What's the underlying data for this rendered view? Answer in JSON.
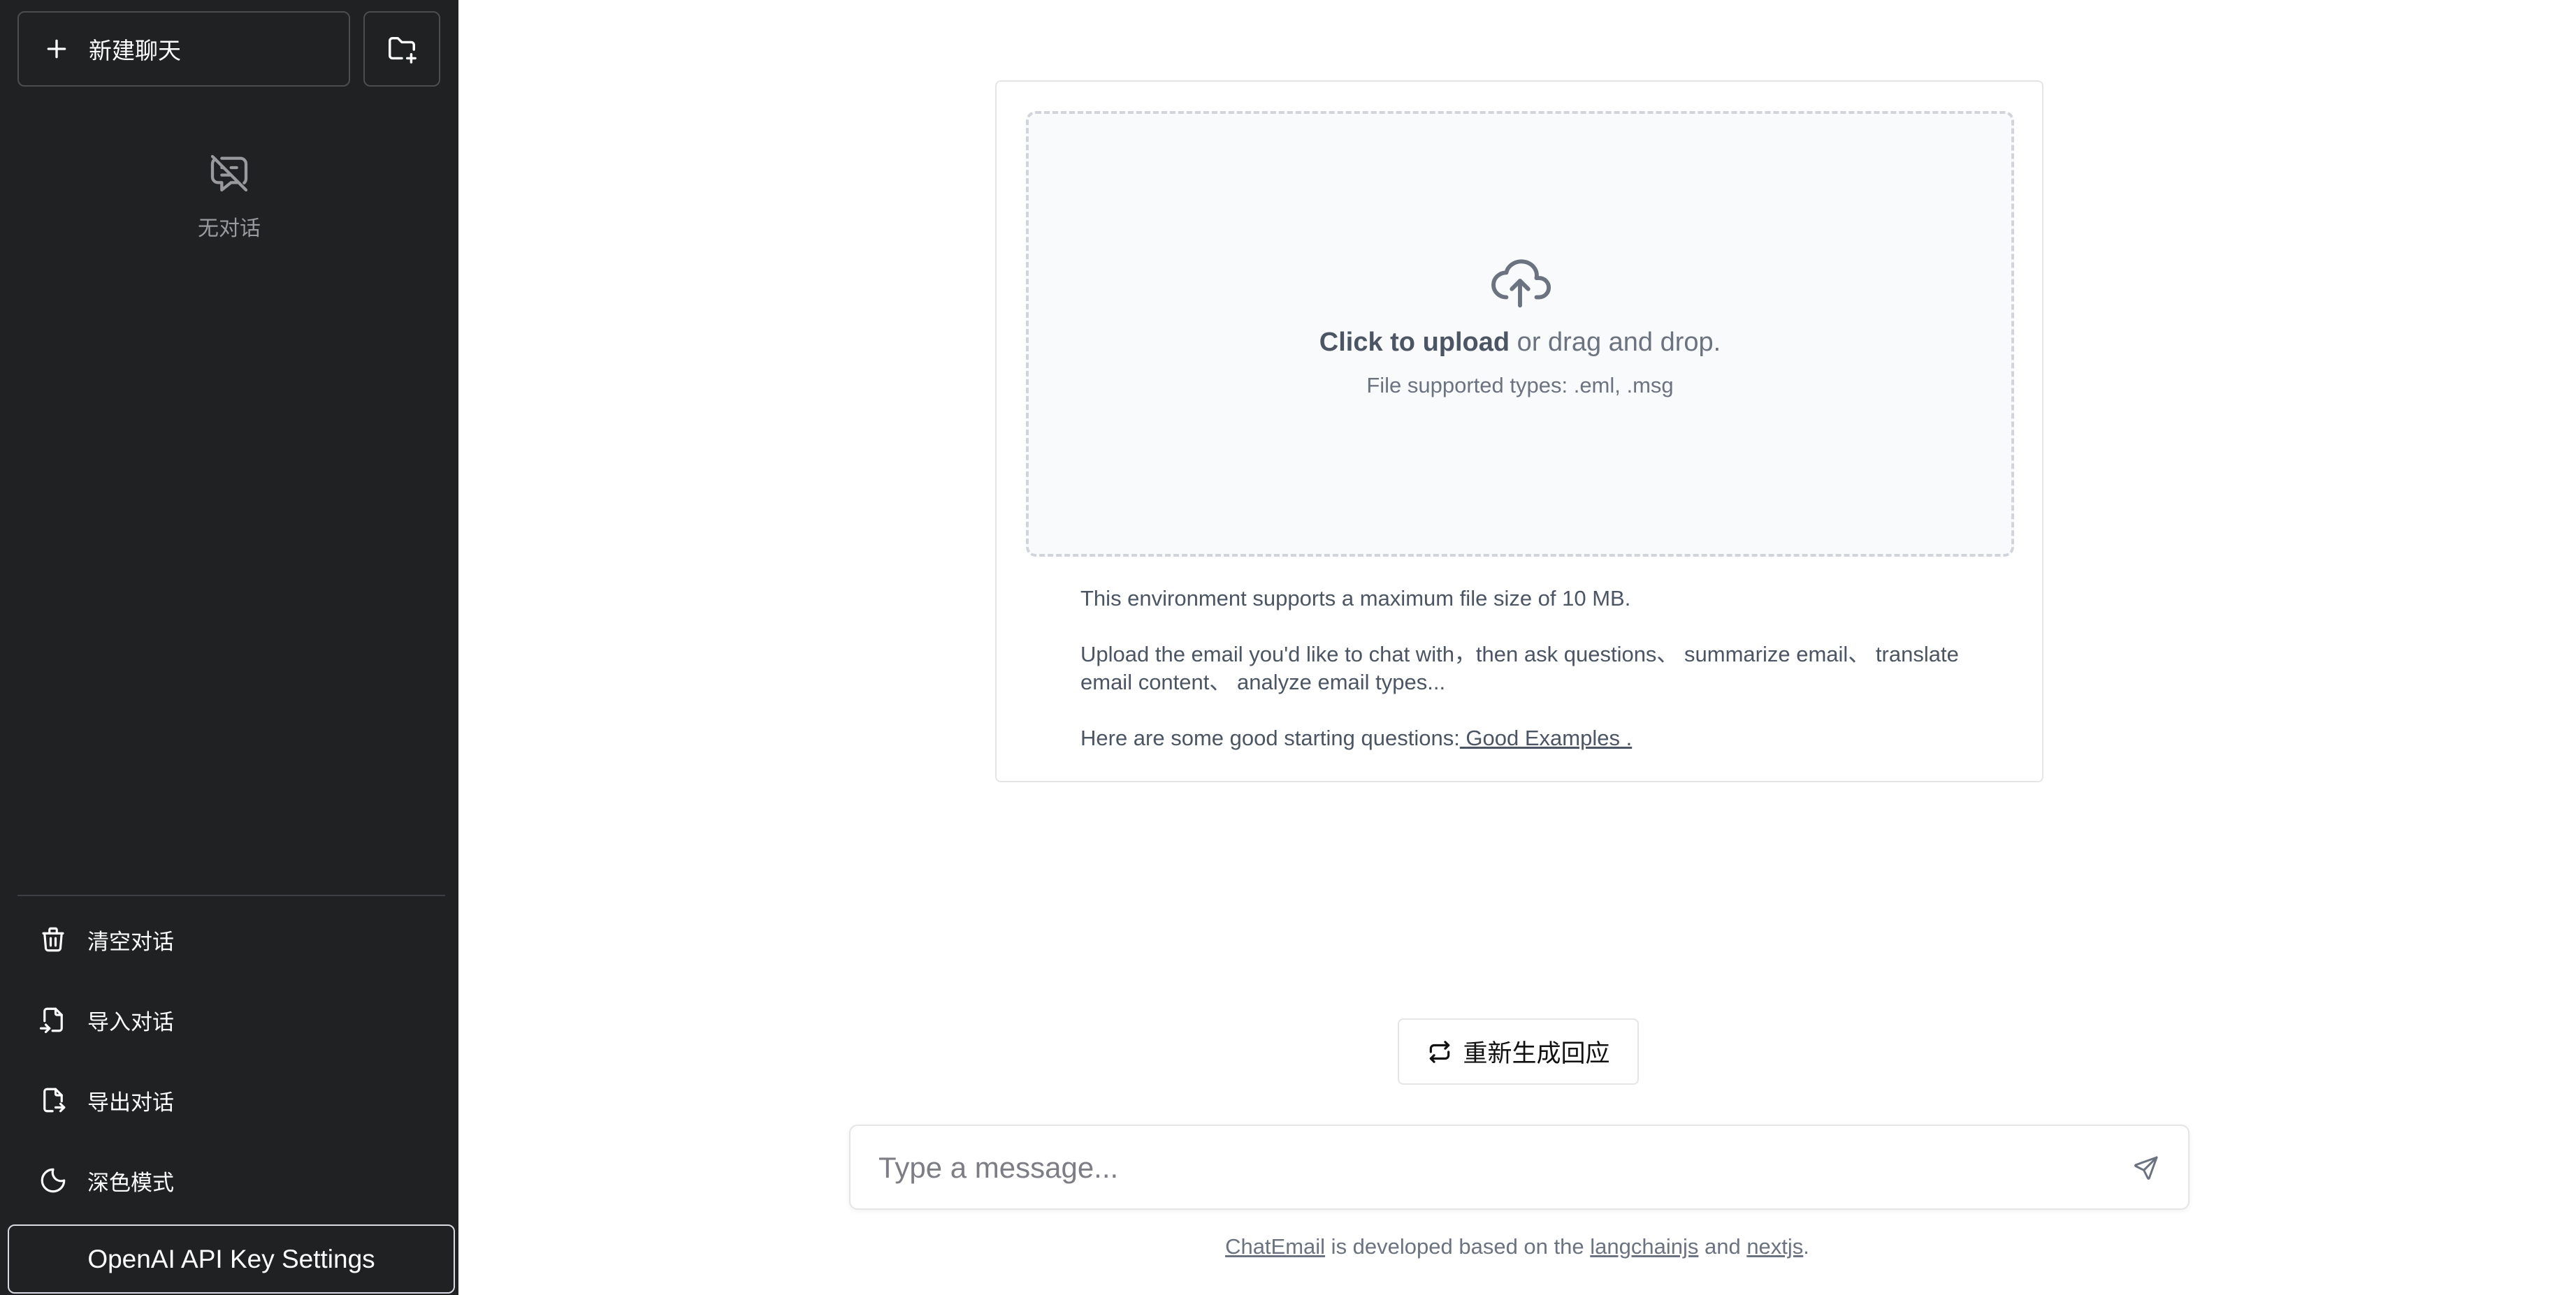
{
  "sidebar": {
    "new_chat_label": "新建聊天",
    "empty_label": "无对话",
    "menu": {
      "clear_label": "清空对话",
      "import_label": "导入对话",
      "export_label": "导出对话",
      "dark_mode_label": "深色模式"
    },
    "api_key_label": "OpenAI API Key Settings",
    "icons": {
      "new_chat": "plus-icon",
      "new_folder": "folder-plus-icon",
      "empty": "message-off-icon",
      "clear": "trash-icon",
      "import": "file-import-icon",
      "export": "file-export-icon",
      "dark_mode": "moon-icon"
    }
  },
  "upload": {
    "cta_bold": "Click to upload",
    "cta_rest": " or drag and drop.",
    "types": "File supported types: .eml, .msg",
    "info_size": "This environment supports a maximum file size of 10 MB.",
    "info_usage": "Upload the email you'd like to chat with，then ask questions、 summarize email、 translate email content、 analyze email types...",
    "info_questions_prefix": "Here are some good starting questions:",
    "info_questions_link": " Good Examples .",
    "icon": "cloud-upload-icon"
  },
  "regenerate_label": "重新生成回应",
  "composer": {
    "placeholder": "Type a message...",
    "send_icon": "send-icon"
  },
  "footer": {
    "link1": "ChatEmail",
    "text1": " is developed based on the ",
    "link2": "langchainjs",
    "text2": " and ",
    "link3": "nextjs",
    "text3": "."
  },
  "colors": {
    "sidebar_bg": "#202123",
    "main_bg": "#ffffff",
    "dropzone_bg": "#f9fafb"
  }
}
